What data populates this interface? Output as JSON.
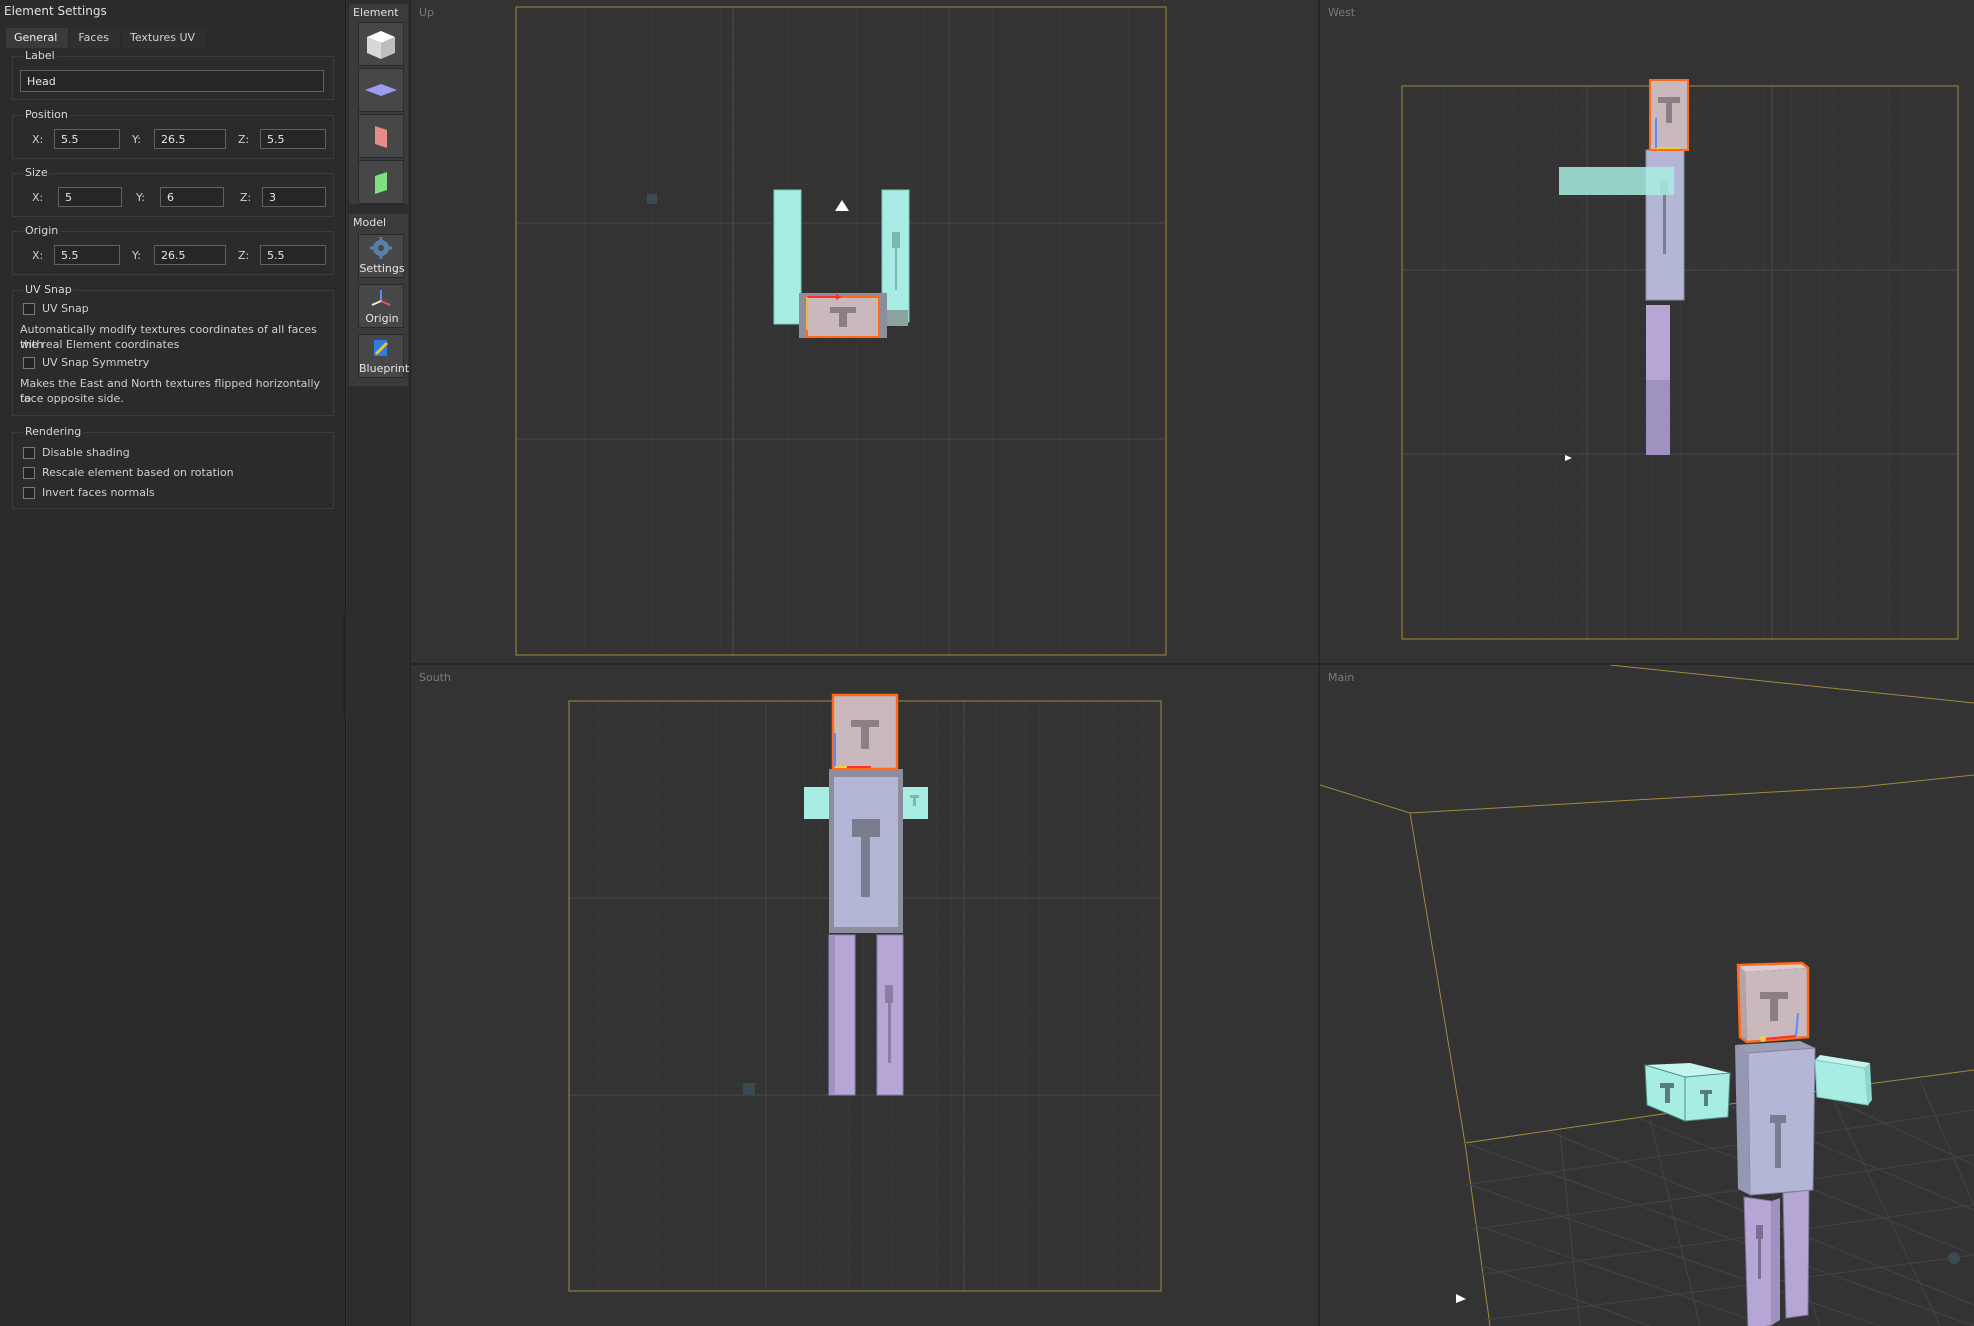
{
  "left_panel": {
    "title": "Element Settings",
    "tabs": [
      {
        "label": "General",
        "active": true
      },
      {
        "label": "Faces",
        "active": false
      },
      {
        "label": "Textures UV",
        "active": false
      }
    ],
    "label_group": {
      "title": "Label",
      "value": "Head"
    },
    "position": {
      "title": "Position",
      "x_label": "X:",
      "y_label": "Y:",
      "z_label": "Z:",
      "x": "5.5",
      "y": "26.5",
      "z": "5.5"
    },
    "size": {
      "title": "Size",
      "x_label": "X:",
      "y_label": "Y:",
      "z_label": "Z:",
      "x": "5",
      "y": "6",
      "z": "3"
    },
    "origin": {
      "title": "Origin",
      "x_label": "X:",
      "y_label": "Y:",
      "z_label": "Z:",
      "x": "5.5",
      "y": "26.5",
      "z": "5.5"
    },
    "uv_snap": {
      "title": "UV Snap",
      "snap_label": "UV Snap",
      "snap_checked": false,
      "snap_desc_1": "Automatically modify textures coordinates of all faces with",
      "snap_desc_2": "the real Element coordinates",
      "symmetry_label": "UV Snap Symmetry",
      "symmetry_checked": false,
      "symmetry_desc_1": "Makes the East and North textures flipped horizontally to",
      "symmetry_desc_2": "face opposite side."
    },
    "rendering": {
      "title": "Rendering",
      "options": [
        {
          "label": "Disable shading",
          "checked": false
        },
        {
          "label": "Rescale element based on rotation",
          "checked": false
        },
        {
          "label": "Invert faces normals",
          "checked": false
        }
      ]
    }
  },
  "toolbox": {
    "element_title": "Element",
    "element_tools": [
      "cube-icon",
      "plane-icon",
      "face-north-icon",
      "face-east-icon"
    ],
    "model_title": "Model",
    "model_tools": [
      {
        "label": "Settings",
        "icon": "gear-icon"
      },
      {
        "label": "Origin",
        "icon": "axes-icon"
      },
      {
        "label": "Blueprint",
        "icon": "blueprint-icon"
      }
    ]
  },
  "viewports": {
    "up": "Up",
    "west": "West",
    "south": "South",
    "main": "Main"
  },
  "colors": {
    "head": "#c9b9bd",
    "body": "#b4b6d6",
    "arm": "#a8ede3",
    "leg": "#b6a6d6",
    "selection": "#ff6a1a",
    "frame": "#b89a3c",
    "grid": "#3f3f3f"
  }
}
